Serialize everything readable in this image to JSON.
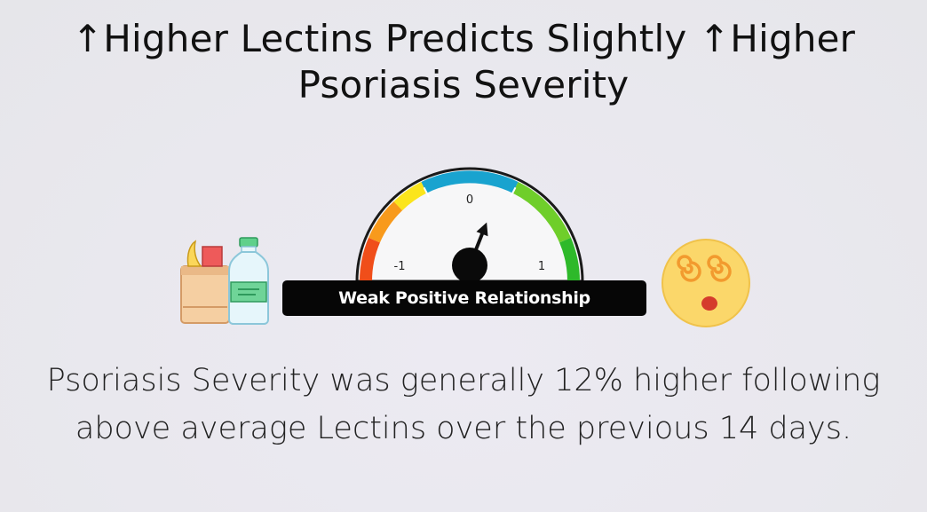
{
  "title": "↑Higher Lectins Predicts Slightly ↑Higher Psoriasis Severity",
  "gauge": {
    "min_label": "-1",
    "mid_label": "0",
    "max_label": "1",
    "relationship": "Weak Positive Relationship",
    "value": 0.15,
    "colors": {
      "red": "#f04e1a",
      "orange": "#f89a1c",
      "yellow": "#fbe51c",
      "blue": "#19a3cf",
      "green": "#6fce2a",
      "darkgreen": "#2eb92a"
    }
  },
  "icons": {
    "left": "groceries-icon",
    "right": "dizzy-face-icon"
  },
  "summary": "Psoriasis Severity was generally 12% higher following above average Lectins over the previous 14 days."
}
